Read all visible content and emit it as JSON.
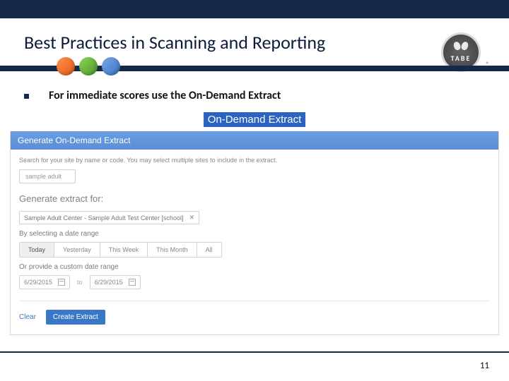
{
  "header": {
    "title": "Best Practices in Scanning and Reporting"
  },
  "logo": {
    "text": "TABE",
    "registered": "®"
  },
  "bullet": {
    "text": "For immediate scores use the On-Demand Extract"
  },
  "highlight": {
    "label": "On-Demand Extract"
  },
  "panel": {
    "title": "Generate On-Demand Extract",
    "search_helper": "Search for your site by name or code. You may select multiple sites to include in the extract.",
    "search_placeholder": "sample adult",
    "generate_heading": "Generate extract for:",
    "selected_site": "Sample Adult Center - Sample Adult Test Center [school]",
    "by_range_label": "By selecting a date range",
    "range_options": [
      "Today",
      "Yesterday",
      "This Week",
      "This Month",
      "All"
    ],
    "custom_label": "Or provide a custom date range",
    "date_from": "6/29/2015",
    "date_to_word": "to",
    "date_to": "6/29/2015",
    "clear_label": "Clear",
    "submit_label": "Create Extract"
  },
  "page_number": "11"
}
